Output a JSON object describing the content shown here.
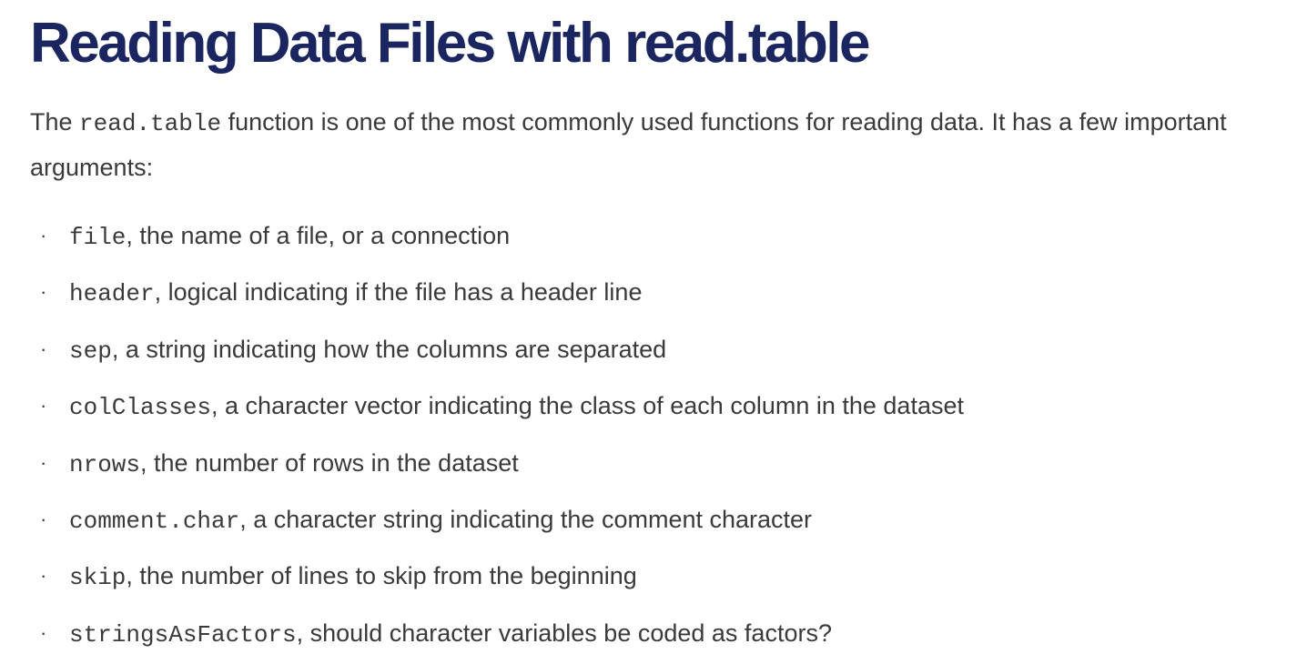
{
  "title": "Reading Data Files with read.table",
  "intro": {
    "prefix": "The ",
    "code": "read.table",
    "rest": " function is one of the most commonly used functions for reading data. It has a few important arguments:"
  },
  "bullet_glyph": "·",
  "arguments": [
    {
      "name": "file",
      "description": ", the name of a file, or a connection"
    },
    {
      "name": "header",
      "description": ", logical indicating if the file has a header line"
    },
    {
      "name": "sep",
      "description": ", a string indicating how the columns are separated"
    },
    {
      "name": "colClasses",
      "description": ", a character vector indicating the class of each column in the dataset"
    },
    {
      "name": "nrows",
      "description": ", the number of rows in the dataset"
    },
    {
      "name": "comment.char",
      "description": ", a character string indicating the comment character"
    },
    {
      "name": "skip",
      "description": ", the number of lines to skip from the beginning"
    },
    {
      "name": "stringsAsFactors",
      "description": ", should character variables be coded as factors?"
    }
  ],
  "colors": {
    "title": "#1b2660",
    "body_text": "#3a3a3a",
    "background": "#ffffff"
  }
}
